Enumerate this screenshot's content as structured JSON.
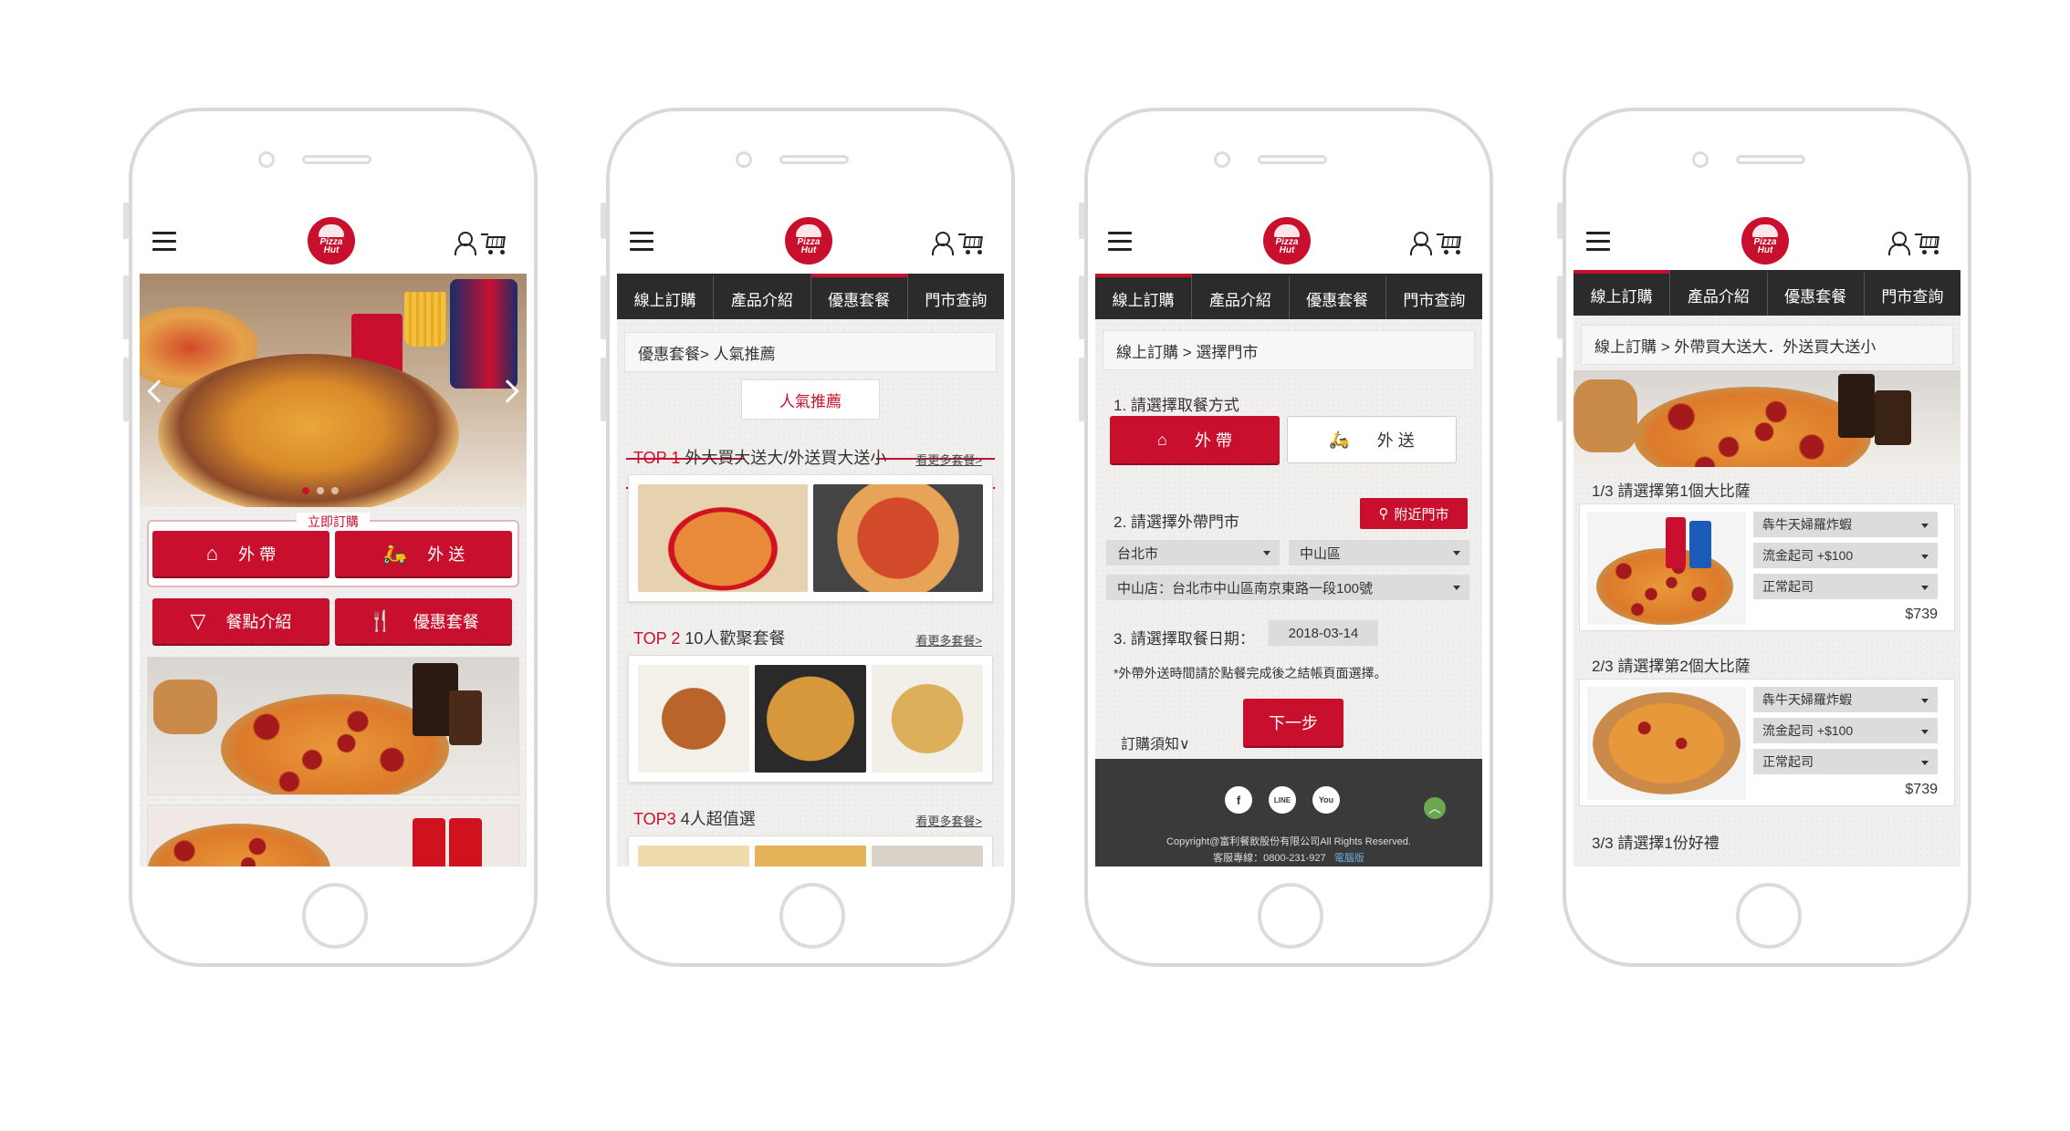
{
  "brand": {
    "logo_text": "Pizza Hut",
    "accent": "#c8102e",
    "dark": "#2b2b2b"
  },
  "nav_tabs": [
    "線上訂購",
    "產品介紹",
    "優惠套餐",
    "門市查詢"
  ],
  "phone1": {
    "order_label": "立即訂購",
    "buttons": {
      "takeout": "外 帶",
      "delivery": "外 送",
      "menu": "餐點介紹",
      "deals": "優惠套餐"
    }
  },
  "phone2": {
    "breadcrumb": "優惠套餐> 人氣推薦",
    "ribbon": "人氣推薦",
    "more": "看更多套餐>",
    "sections": [
      {
        "rank": "TOP 1",
        "title": "外大買大送大/外送買大送小"
      },
      {
        "rank": "TOP 2",
        "title": "10人歡聚套餐"
      },
      {
        "rank": "TOP3",
        "title": "4人超值選"
      }
    ]
  },
  "phone3": {
    "breadcrumb": "線上訂購 > 選擇門市",
    "step1": "1. 請選擇取餐方式",
    "takeout": "外 帶",
    "delivery": "外 送",
    "step2": "2. 請選擇外帶門市",
    "nearby": "附近門市",
    "city": "台北市",
    "district": "中山區",
    "store": "中山店：台北市中山區南京東路一段100號",
    "step3": "3. 請選擇取餐日期：",
    "date": "2018-03-14",
    "note": "*外帶外送時間請於點餐完成後之結帳頁面選擇。",
    "next": "下一步",
    "notice": "訂購須知∨",
    "copyright": "Copyright@富利餐飲股份有限公司All Rights Reserved.",
    "hotline": "客服專線：0800-231-927",
    "desktop": "電腦版",
    "social": [
      "f",
      "LINE",
      "You"
    ]
  },
  "phone4": {
    "breadcrumb": "線上訂購 > 外帶買大送大．外送買大送小",
    "steps": [
      {
        "title": "1/3 請選擇第1個大比薩",
        "options": [
          "犇牛天婦羅炸蝦",
          "流金起司 +$100",
          "正常起司"
        ],
        "price": "$739"
      },
      {
        "title": "2/3 請選擇第2個大比薩",
        "options": [
          "犇牛天婦羅炸蝦",
          "流金起司 +$100",
          "正常起司"
        ],
        "price": "$739"
      },
      {
        "title": "3/3 請選擇1份好禮"
      }
    ]
  }
}
